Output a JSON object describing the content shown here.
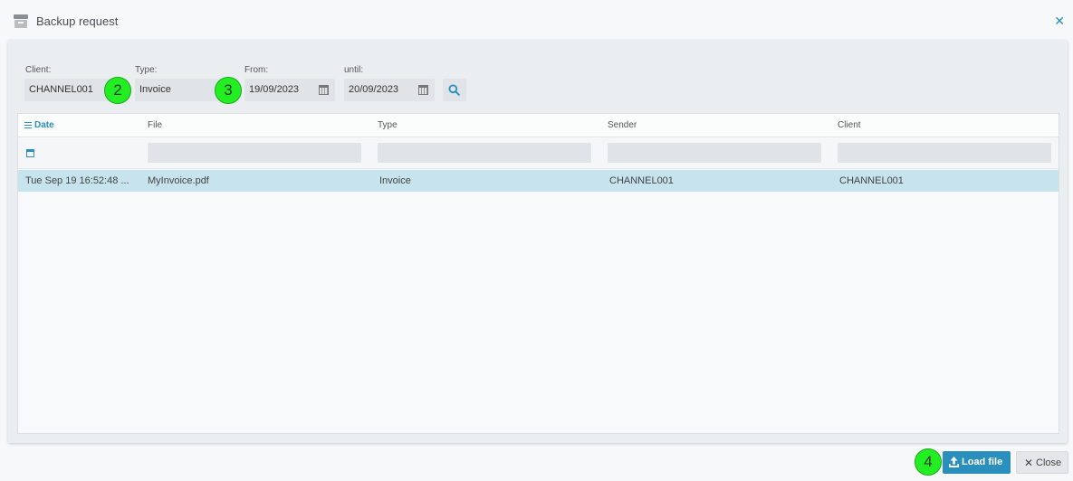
{
  "window": {
    "title": "Backup request"
  },
  "filters": {
    "client_label": "Client:",
    "client_value": "CHANNEL001",
    "type_label": "Type:",
    "type_value": "Invoice",
    "from_label": "From:",
    "from_value": "19/09/2023",
    "until_label": "until:",
    "until_value": "20/09/2023"
  },
  "markers": [
    "2",
    "3",
    "4"
  ],
  "grid": {
    "columns": [
      "Date",
      "File",
      "Type",
      "Sender",
      "Client"
    ],
    "rows": [
      {
        "date": "Tue Sep 19 16:52:48 ...",
        "file": "MyInvoice.pdf",
        "type": "Invoice",
        "sender": "CHANNEL001",
        "client": "CHANNEL001"
      }
    ]
  },
  "footer": {
    "load_label": "Load file",
    "close_label": "Close"
  },
  "colors": {
    "accent": "#2a8fbd",
    "selected_row": "#c6e3ee",
    "marker": "#22ee22"
  }
}
